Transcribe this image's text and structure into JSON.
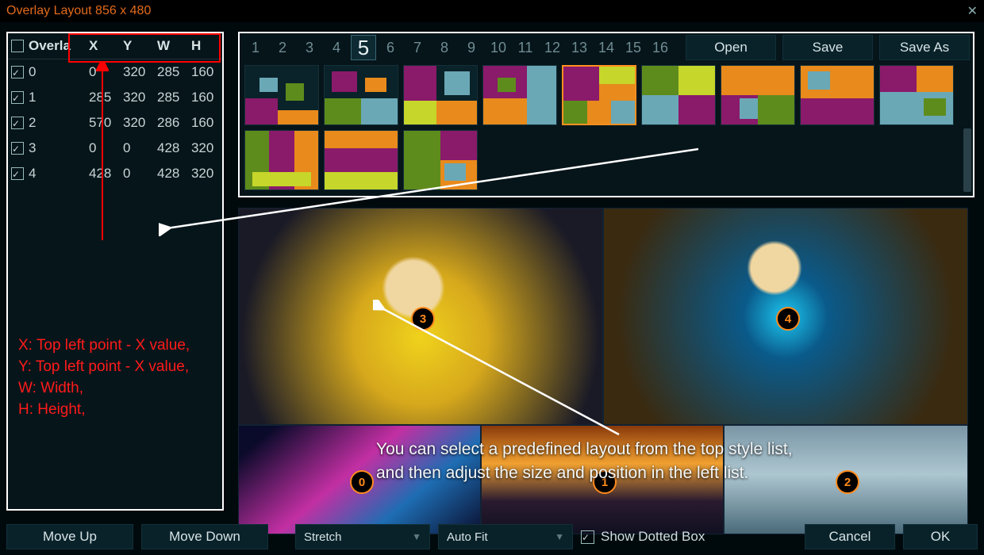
{
  "window": {
    "title": "Overlay Layout 856 x 480"
  },
  "table": {
    "headers": {
      "overlay": "Overla",
      "x": "X",
      "y": "Y",
      "w": "W",
      "h": "H"
    },
    "rows": [
      {
        "checked": true,
        "id": "0",
        "x": "0",
        "y": "320",
        "w": "285",
        "h": "160"
      },
      {
        "checked": true,
        "id": "1",
        "x": "285",
        "y": "320",
        "w": "285",
        "h": "160"
      },
      {
        "checked": true,
        "id": "2",
        "x": "570",
        "y": "320",
        "w": "286",
        "h": "160"
      },
      {
        "checked": true,
        "id": "3",
        "x": "0",
        "y": "0",
        "w": "428",
        "h": "320"
      },
      {
        "checked": true,
        "id": "4",
        "x": "428",
        "y": "0",
        "w": "428",
        "h": "320"
      }
    ]
  },
  "help": {
    "text": "X: Top left point - X value,\nY: Top left point - X value,\nW: Width,\nH: Height,"
  },
  "presets": {
    "numbers": [
      "1",
      "2",
      "3",
      "4",
      "5",
      "6",
      "7",
      "8",
      "9",
      "10",
      "11",
      "12",
      "13",
      "14",
      "15",
      "16"
    ],
    "selected": "5",
    "actions": {
      "open": "Open",
      "save": "Save",
      "saveas": "Save As"
    }
  },
  "hint": {
    "line1": "You can select a predefined layout from the top style list,",
    "line2": "and then adjust the size and position in the left list."
  },
  "badges": {
    "ov0": "0",
    "ov1": "1",
    "ov2": "2",
    "ov3": "3",
    "ov4": "4"
  },
  "bottom": {
    "moveup": "Move Up",
    "movedown": "Move Down",
    "stretch": "Stretch",
    "autofit": "Auto Fit",
    "showdotted": "Show Dotted Box",
    "cancel": "Cancel",
    "ok": "OK"
  }
}
